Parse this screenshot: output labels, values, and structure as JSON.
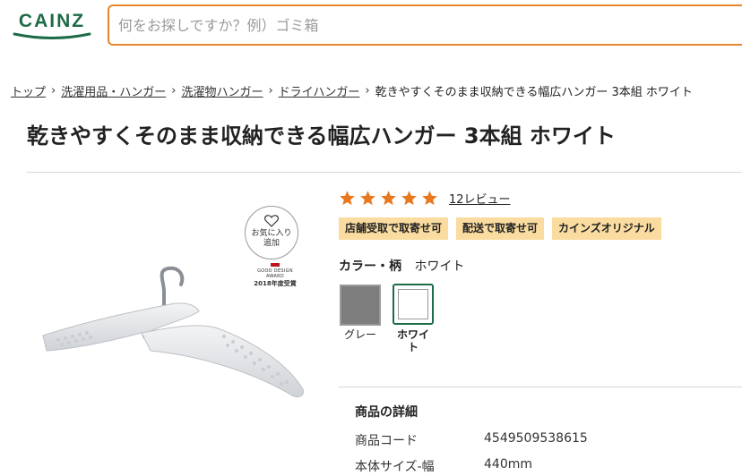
{
  "header": {
    "logo_text": "CAINZ",
    "search": {
      "placeholder": "何をお探しですか？例）ゴミ箱",
      "value": ""
    }
  },
  "breadcrumb": [
    "トップ",
    "洗濯用品・ハンガー",
    "洗濯物ハンガー",
    "ドライハンガー"
  ],
  "breadcrumb_current": "乾きやすくそのまま収納できる幅広ハンガー 3本組 ホワイト",
  "product": {
    "title": "乾きやすくそのまま収納できる幅広ハンガー 3本組 ホワイト",
    "favorite_label_line1": "お気に入り",
    "favorite_label_line2": "追加",
    "award_line1": "GOOD DESIGN AWARD",
    "award_line2": "2018年度受賞",
    "rating": {
      "stars": 5,
      "reviews_label": "12レビュー"
    },
    "badges": [
      "店舗受取で取寄せ可",
      "配送で取寄せ可",
      "カインズオリジナル"
    ],
    "color": {
      "label": "カラー・柄",
      "selected": "ホワイト",
      "options": [
        {
          "name": "グレー",
          "color": "#7d7d7d"
        },
        {
          "name_line1": "ホワイ",
          "name_line2": "ト",
          "color": "#ffffff"
        }
      ]
    },
    "details": {
      "heading": "商品の詳細",
      "rows": [
        {
          "label": "商品コード",
          "value": "4549509538615"
        },
        {
          "label": "本体サイズ-幅",
          "value": "440mm"
        }
      ]
    }
  },
  "colors": {
    "brand": "#1d6b46",
    "accent": "#e6862c",
    "star": "#e8781e",
    "badge": "#fbdca0"
  },
  "icons": {
    "favorite": "heart-icon",
    "breadcrumb_separator": "chevron-right-icon",
    "rating": "star-icon"
  }
}
